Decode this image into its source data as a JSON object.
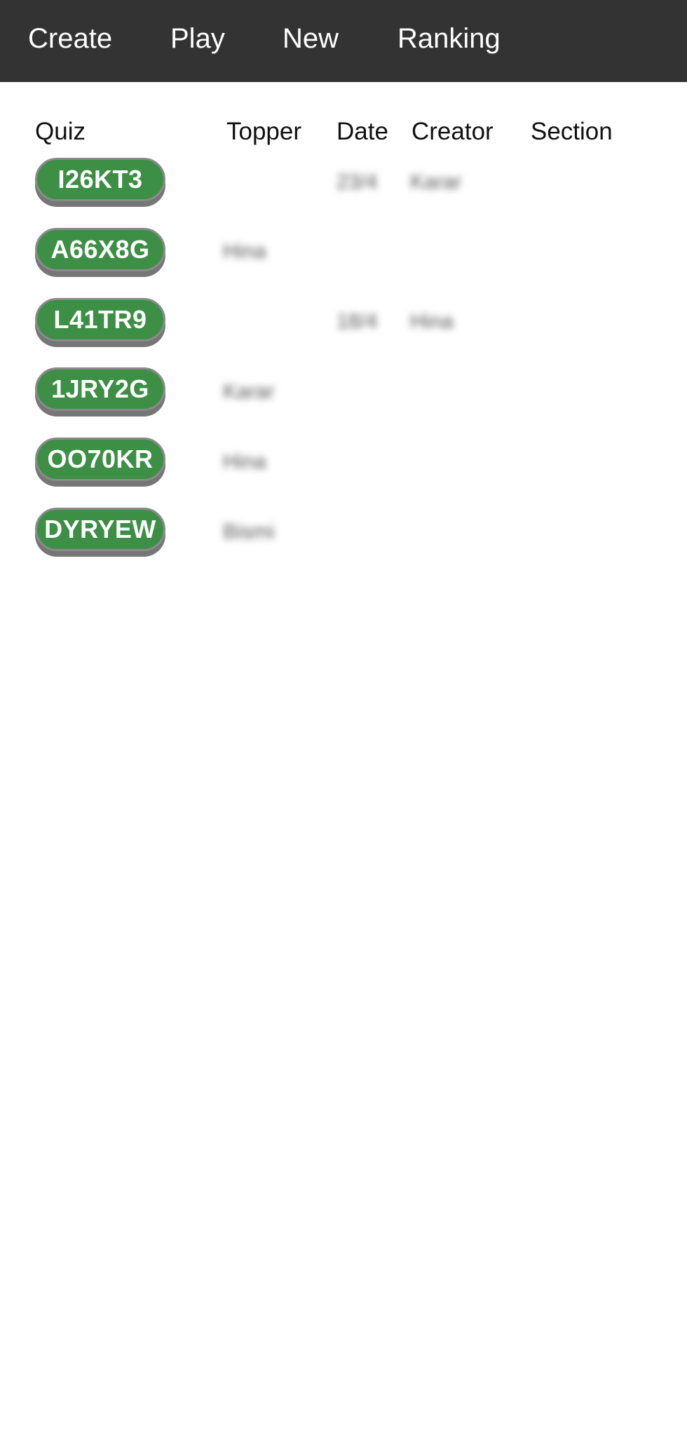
{
  "nav": {
    "items": [
      {
        "label": "Create"
      },
      {
        "label": "Play"
      },
      {
        "label": "New"
      },
      {
        "label": "Ranking"
      }
    ]
  },
  "table": {
    "headers": {
      "quiz": "Quiz",
      "topper": "Topper",
      "date": "Date",
      "creator": "Creator",
      "section": "Section"
    },
    "rows": [
      {
        "quiz": "I26KT3",
        "topper": "",
        "date": "23/4",
        "creator": "Karar",
        "section": ""
      },
      {
        "quiz": "A66X8G",
        "topper": "Hina",
        "date": "",
        "creator": "",
        "section": ""
      },
      {
        "quiz": "L41TR9",
        "topper": "",
        "date": "18/4",
        "creator": "Hina",
        "section": ""
      },
      {
        "quiz": "1JRY2G",
        "topper": "Karar",
        "date": "",
        "creator": "",
        "section": ""
      },
      {
        "quiz": "OO70KR",
        "topper": "Hina",
        "date": "",
        "creator": "",
        "section": ""
      },
      {
        "quiz": "DYRYEW",
        "topper": "Bismi",
        "date": "",
        "creator": "",
        "section": ""
      }
    ]
  },
  "colors": {
    "topbar": "#333333",
    "quiz_button": "#3d8f46",
    "quiz_button_shadow": "#767676"
  }
}
